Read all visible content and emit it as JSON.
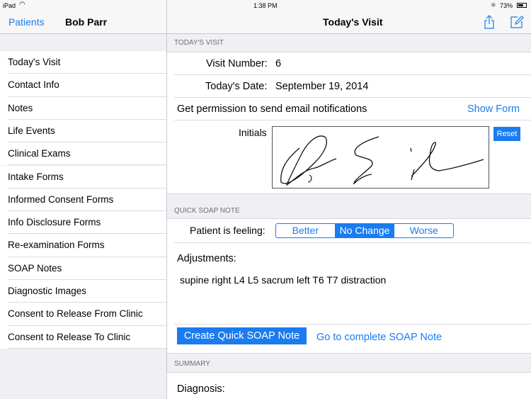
{
  "status": {
    "device": "iPad",
    "time": "1:38 PM",
    "battery": "73%"
  },
  "nav": {
    "back": "Patients",
    "patient": "Bob Parr",
    "title": "Today's Visit"
  },
  "sidebar": {
    "items": [
      "Today's Visit",
      "Contact Info",
      "Notes",
      "Life Events",
      "Clinical Exams",
      "Intake Forms",
      "Informed Consent Forms",
      "Info Disclosure Forms",
      "Re-examination Forms",
      "SOAP Notes",
      "Diagnostic Images",
      "Consent to Release From Clinic",
      "Consent to Release To Clinic"
    ]
  },
  "visit": {
    "header": "TODAY'S VISIT",
    "visit_number_label": "Visit Number:",
    "visit_number": "6",
    "date_label": "Today's Date:",
    "date": "September 19, 2014",
    "permission": "Get permission to send email notifications",
    "show_form": "Show Form",
    "initials_label": "Initials",
    "reset": "Reset"
  },
  "soap": {
    "header": "QUICK SOAP NOTE",
    "feeling_label": "Patient is feeling:",
    "options": [
      "Better",
      "No Change",
      "Worse"
    ],
    "selected": "No Change",
    "adjustments_label": "Adjustments:",
    "adjustments": "supine right L4 L5 sacrum left T6 T7 distraction",
    "create": "Create Quick SOAP Note",
    "goto": "Go to complete SOAP Note"
  },
  "summary": {
    "header": "SUMMARY",
    "diagnosis_label": "Diagnosis:"
  },
  "colors": {
    "accent": "#1a7cf0",
    "group_bg": "#efeff4"
  }
}
